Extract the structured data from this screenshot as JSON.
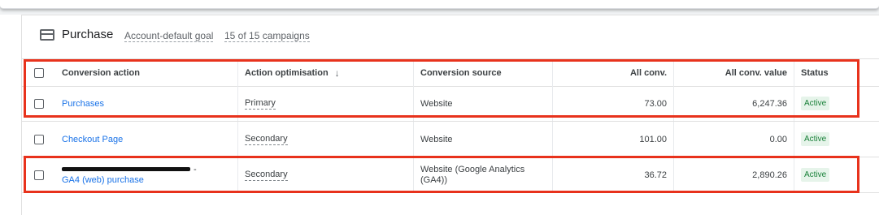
{
  "card": {
    "title": "Purchase",
    "goal_link": "Account-default goal",
    "campaigns_link": "15 of 15 campaigns"
  },
  "table": {
    "headers": {
      "conversion_action": "Conversion action",
      "action_optimisation": "Action optimisation",
      "conversion_source": "Conversion source",
      "all_conv": "All conv.",
      "all_conv_value": "All conv. value",
      "status": "Status"
    },
    "rows": [
      {
        "action": "Purchases",
        "optimisation": "Primary",
        "source": "Website",
        "all_conv": "73.00",
        "all_conv_value": "6,247.36",
        "status": "Active"
      },
      {
        "action": "Checkout Page",
        "optimisation": "Secondary",
        "source": "Website",
        "all_conv": "101.00",
        "all_conv_value": "0.00",
        "status": "Active"
      },
      {
        "action_prefix": "-",
        "action": "GA4 (web) purchase",
        "optimisation": "Secondary",
        "source_line1": "Website (Google Analytics",
        "source_line2": "(GA4))",
        "all_conv": "36.72",
        "all_conv_value": "2,890.26",
        "status": "Active"
      }
    ]
  },
  "colors": {
    "link": "#1a73e8",
    "active_badge_bg": "#e6f4ea",
    "active_badge_text": "#188038",
    "highlight": "#e8321c"
  },
  "icons": {
    "card_icon": "credit-card-icon",
    "sort_icon": "arrow-down-icon"
  }
}
